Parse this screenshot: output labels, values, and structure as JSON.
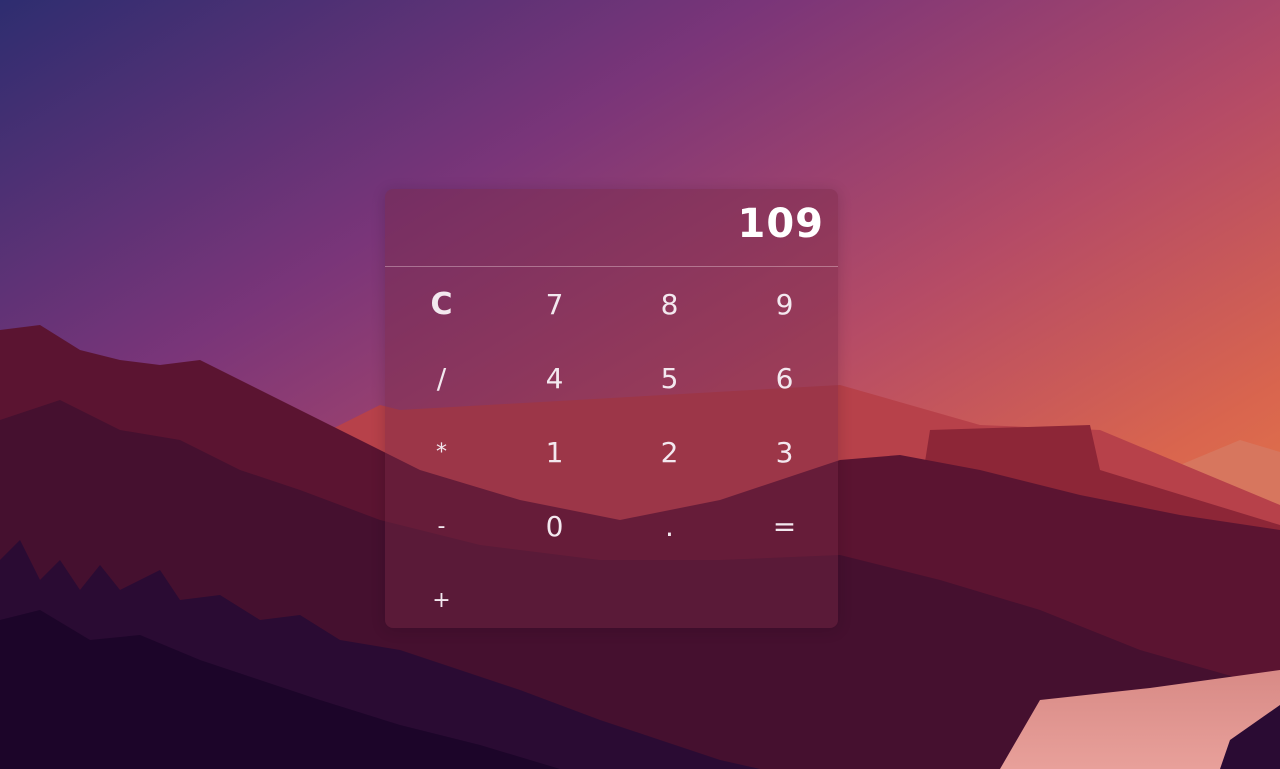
{
  "display": {
    "value": "109"
  },
  "keys": {
    "clear": "C",
    "seven": "7",
    "eight": "8",
    "nine": "9",
    "divide": "/",
    "four": "4",
    "five": "5",
    "six": "6",
    "multiply": "*",
    "one": "1",
    "two": "2",
    "three": "3",
    "subtract": "-",
    "zero": "0",
    "decimal": ".",
    "equals": "=",
    "add": "+"
  },
  "colors": {
    "sky_top": "#2f2c6e",
    "sky_mid": "#a9456f",
    "horizon": "#e3744a",
    "panel": "#7a2846",
    "text": "#ffffff"
  }
}
